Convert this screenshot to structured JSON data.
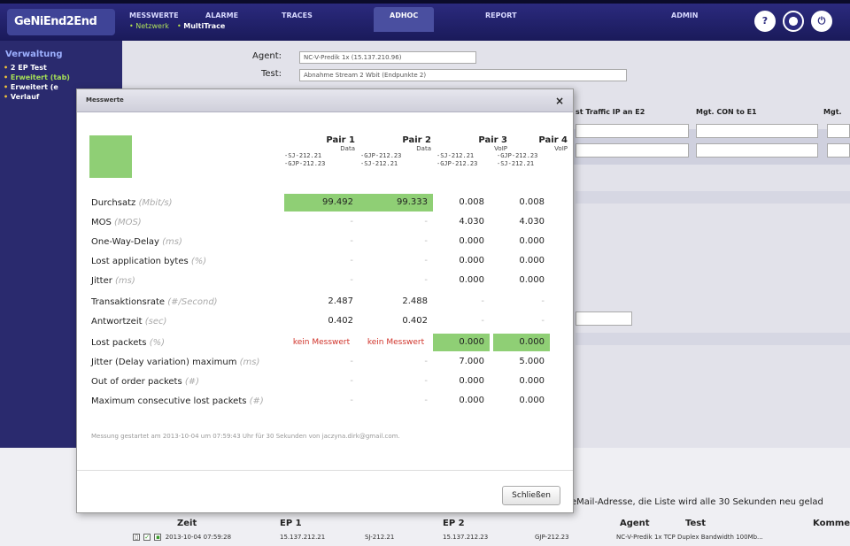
{
  "app": {
    "logo": "GeNiEnd2End"
  },
  "nav": {
    "items": [
      "MESSWERTE",
      "ALARME",
      "TRACES",
      "ADHOC",
      "REPORT",
      "ADMIN"
    ],
    "active": "ADHOC",
    "sub_items": [
      "Netzwerk",
      "MultiTrace"
    ],
    "icons": [
      "help-icon",
      "user-icon",
      "logout-icon"
    ]
  },
  "sidebar": {
    "title": "Verwaltung",
    "items": [
      "2 EP Test",
      "Erweitert (tab)",
      "Erweitert (e",
      "Verlauf"
    ]
  },
  "background_form": {
    "agent_label": "Agent:",
    "agent_value": "NC-V-Predik 1x (15.137.210.96)",
    "test_label": "Test:",
    "test_value": "Abnahme Stream 2 Wbit (Endpunkte 2)",
    "columns": [
      "st Traffic IP an E2",
      "Mgt. CON to E1",
      "Mgt."
    ]
  },
  "modal": {
    "title": "Messwerte",
    "close_label": "×",
    "pairs": [
      {
        "name": "Pair 1",
        "type": "Data",
        "ep1": "-SJ-212.21",
        "ep2": "-GJP-212.23"
      },
      {
        "name": "Pair 2",
        "type": "Data",
        "ep1": "-GJP-212.23",
        "ep2": "-SJ-212.21"
      },
      {
        "name": "Pair 3",
        "type": "VoIP",
        "ep1": "-SJ-212.21",
        "ep2": "-GJP-212.23"
      },
      {
        "name": "Pair 4",
        "type": "VoIP",
        "ep1": "-GJP-212.23",
        "ep2": "-SJ-212.21"
      }
    ],
    "metrics": [
      {
        "label": "Durchsatz",
        "unit": "(Mbit/s)",
        "values": [
          "99.492",
          "99.333",
          "0.008",
          "0.008"
        ]
      },
      {
        "label": "MOS",
        "unit": "(MOS)",
        "values": [
          "-",
          "-",
          "4.030",
          "4.030"
        ]
      },
      {
        "label": "One-Way-Delay",
        "unit": "(ms)",
        "values": [
          "-",
          "-",
          "0.000",
          "0.000"
        ]
      },
      {
        "label": "Lost application bytes",
        "unit": "(%)",
        "values": [
          "-",
          "-",
          "0.000",
          "0.000"
        ]
      },
      {
        "label": "Jitter",
        "unit": "(ms)",
        "values": [
          "-",
          "-",
          "0.000",
          "0.000"
        ]
      },
      {
        "label": "Transaktionsrate",
        "unit": "(#/Second)",
        "values": [
          "2.487",
          "2.488",
          "-",
          "-"
        ]
      },
      {
        "label": "Antwortzeit",
        "unit": "(sec)",
        "values": [
          "0.402",
          "0.402",
          "-",
          "-"
        ]
      },
      {
        "label": "Lost packets",
        "unit": "(%)",
        "values": [
          "kein Messwert",
          "kein Messwert",
          "0.000",
          "0.000"
        ]
      },
      {
        "label": "Jitter (Delay variation) maximum",
        "unit": "(ms)",
        "values": [
          "-",
          "-",
          "7.000",
          "5.000"
        ]
      },
      {
        "label": "Out of order packets",
        "unit": "(#)",
        "values": [
          "-",
          "-",
          "0.000",
          "0.000"
        ]
      },
      {
        "label": "Maximum consecutive lost packets",
        "unit": "(#)",
        "values": [
          "-",
          "-",
          "0.000",
          "0.000"
        ]
      }
    ],
    "footnote": "Messung gestartet am 2013-10-04 um 07:59:43 Uhr für 30 Sekunden von jaczyna.dirk@gmail.com.",
    "close_button": "Schließen",
    "colors": {
      "green": "#8fcf75",
      "warning": "#d0332a"
    }
  },
  "bottom": {
    "info_text": "eMail-Adresse, die Liste wird alle 30 Sekunden neu gelad",
    "table_headers": [
      "Zeit",
      "EP 1",
      "EP 2",
      "Agent",
      "Test",
      "Kommen"
    ],
    "row": {
      "time": "2013-10-04 07:59:28",
      "ep1_ip": "15.137.212.21",
      "ep1_name": "SJ-212.21",
      "ep2_ip": "15.137.212.23",
      "ep2_name": "GJP-212.23",
      "agent_test": "NC-V-Predik 1x TCP Duplex Bandwidth 100Mb..."
    }
  }
}
